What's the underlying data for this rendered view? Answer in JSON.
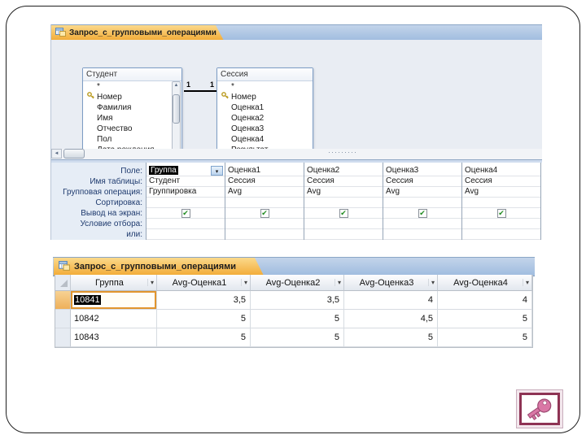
{
  "glyphs": {
    "dropdown": "▾",
    "check": "✔",
    "scroll_left": "◄",
    "scroll_up": "▲",
    "scroll_down": "▼",
    "splitter_dots": "·········",
    "asterisk": "*"
  },
  "colors": {
    "active_tab_orange": "#f2ab36",
    "tab_strip_blue": "#9fbcdf",
    "selection_black": "#000000",
    "current_cell_border": "#e1952f",
    "check_green": "#1d8a1d",
    "key_frame_maroon": "#8e3354",
    "key_pink": "#d977a5"
  },
  "design_view": {
    "tab_title": "Запрос_с_групповыми_операциями",
    "tables": [
      {
        "title": "Студент",
        "fields": [
          "*",
          "Номер",
          "Фамилия",
          "Имя",
          "Отчество",
          "Пол",
          "Дата рождения"
        ]
      },
      {
        "title": "Сессия",
        "fields": [
          "*",
          "Номер",
          "Оценка1",
          "Оценка2",
          "Оценка3",
          "Оценка4",
          "Результат"
        ]
      }
    ],
    "relationship": {
      "left_label": "1",
      "right_label": "1"
    },
    "grid": {
      "row_labels": [
        "Поле:",
        "Имя таблицы:",
        "Групповая операция:",
        "Сортировка:",
        "Вывод на экран:",
        "Условие отбора:",
        "или:"
      ],
      "columns": [
        {
          "field": "Группа",
          "table": "Студент",
          "group_op": "Группировка"
        },
        {
          "field": "Оценка1",
          "table": "Сессия",
          "group_op": "Avg"
        },
        {
          "field": "Оценка2",
          "table": "Сессия",
          "group_op": "Avg"
        },
        {
          "field": "Оценка3",
          "table": "Сессия",
          "group_op": "Avg"
        },
        {
          "field": "Оценка4",
          "table": "Сессия",
          "group_op": "Avg"
        }
      ]
    }
  },
  "datasheet": {
    "tab_title": "Запрос_с_групповыми_операциями",
    "headers": [
      "Группа",
      "Avg-Оценка1",
      "Avg-Оценка2",
      "Avg-Оценка3",
      "Avg-Оценка4"
    ],
    "rows": [
      [
        "10841",
        "3,5",
        "3,5",
        "4",
        "4"
      ],
      [
        "10842",
        "5",
        "5",
        "4,5",
        "5"
      ],
      [
        "10843",
        "5",
        "5",
        "5",
        "5"
      ]
    ]
  }
}
